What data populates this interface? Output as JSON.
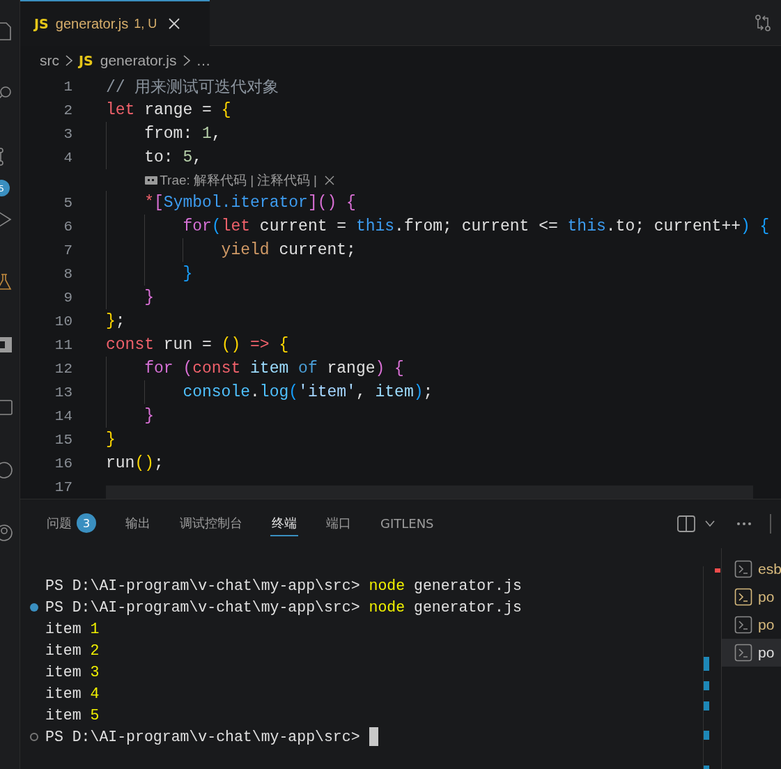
{
  "activity_bar": {
    "items": [
      {
        "kind": "files"
      },
      {
        "kind": "search"
      },
      {
        "kind": "source_control",
        "badge": "5"
      },
      {
        "kind": "run"
      },
      {
        "kind": "flask"
      },
      {
        "kind": "filled_square"
      },
      {
        "kind": "window"
      },
      {
        "kind": "circle"
      },
      {
        "kind": "account"
      }
    ]
  },
  "editor_tabs": [
    {
      "icon": "JS",
      "title": "generator.js",
      "status": "1, U",
      "selected": true
    }
  ],
  "breadcrumbs": [
    {
      "text": "src"
    },
    {
      "icon": "JS",
      "text": "generator.js"
    },
    {
      "text": "…"
    }
  ],
  "code": {
    "lines": [
      {
        "kind": "code",
        "number": "1",
        "tokens": [
          {
            "t": "// 用来测试可迭代对象",
            "kind": "comment"
          }
        ]
      },
      {
        "kind": "code",
        "number": "2",
        "tokens": [
          {
            "t": "let",
            "kind": "kw"
          },
          {
            "t": " range = ",
            "kind": "plain"
          },
          {
            "t": "{",
            "kind": "b1"
          }
        ],
        "children": [
          {
            "kind": "code",
            "number": "3",
            "tokens": [
              {
                "t": "from: ",
                "kind": "plain"
              },
              {
                "t": "1",
                "kind": "num"
              },
              {
                "t": ",",
                "kind": "plain"
              }
            ]
          },
          {
            "kind": "code",
            "number": "4",
            "tokens": [
              {
                "t": "to: ",
                "kind": "plain"
              },
              {
                "t": "5",
                "kind": "num"
              },
              {
                "t": ",",
                "kind": "plain"
              }
            ]
          },
          {
            "kind": "codelens",
            "prefix": "Trae:",
            "actions": [
              "解释代码",
              "注释代码"
            ],
            "separator": "|"
          },
          {
            "kind": "code",
            "number": "5",
            "tokens": [
              {
                "t": "*",
                "kind": "kw"
              },
              {
                "t": "[",
                "kind": "b2"
              },
              {
                "t": "Symbol.iterator",
                "kind": "this"
              },
              {
                "t": "]() {",
                "kind": "b2"
              }
            ],
            "children": [
              {
                "kind": "code",
                "number": "6",
                "tokens": [
                  {
                    "t": "for",
                    "kind": "ctrl"
                  },
                  {
                    "t": "(",
                    "kind": "b3"
                  },
                  {
                    "t": "let",
                    "kind": "kw"
                  },
                  {
                    "t": " current = ",
                    "kind": "plain"
                  },
                  {
                    "t": "this",
                    "kind": "this"
                  },
                  {
                    "t": ".from; current <= ",
                    "kind": "plain"
                  },
                  {
                    "t": "this",
                    "kind": "this"
                  },
                  {
                    "t": ".to; current++",
                    "kind": "plain"
                  },
                  {
                    "t": ") {",
                    "kind": "b3"
                  }
                ],
                "children": [
                  {
                    "kind": "code",
                    "number": "7",
                    "tokens": [
                      {
                        "t": "yield",
                        "kind": "yield"
                      },
                      {
                        "t": " current;",
                        "kind": "plain"
                      }
                    ]
                  }
                ]
              },
              {
                "kind": "code",
                "number": "8",
                "tokens": [
                  {
                    "t": "}",
                    "kind": "b3"
                  }
                ]
              }
            ]
          },
          {
            "kind": "code",
            "number": "9",
            "tokens": [
              {
                "t": "}",
                "kind": "b2"
              }
            ]
          }
        ]
      },
      {
        "kind": "code",
        "number": "10",
        "tokens": [
          {
            "t": "}",
            "kind": "b1"
          },
          {
            "t": ";",
            "kind": "plain"
          }
        ]
      },
      {
        "kind": "code",
        "number": "11",
        "tokens": [
          {
            "t": "const",
            "kind": "kw"
          },
          {
            "t": " run = ",
            "kind": "plain"
          },
          {
            "t": "() ",
            "kind": "b1"
          },
          {
            "t": "=> ",
            "kind": "kw"
          },
          {
            "t": "{",
            "kind": "b1"
          }
        ],
        "children": [
          {
            "kind": "code",
            "number": "12",
            "tokens": [
              {
                "t": "for ",
                "kind": "ctrl"
              },
              {
                "t": "(",
                "kind": "b2"
              },
              {
                "t": "const ",
                "kind": "kw"
              },
              {
                "t": "item ",
                "kind": "var"
              },
              {
                "t": "of",
                "kind": "storage"
              },
              {
                "t": " range",
                "kind": "plain"
              },
              {
                "t": ") {",
                "kind": "b2"
              }
            ],
            "children": [
              {
                "kind": "code",
                "number": "13",
                "tokens": [
                  {
                    "t": "console",
                    "kind": "builtin"
                  },
                  {
                    "t": ".",
                    "kind": "plain"
                  },
                  {
                    "t": "log",
                    "kind": "builtin"
                  },
                  {
                    "t": "(",
                    "kind": "b3"
                  },
                  {
                    "t": "'item'",
                    "kind": "string"
                  },
                  {
                    "t": ", ",
                    "kind": "plain"
                  },
                  {
                    "t": "item",
                    "kind": "var"
                  },
                  {
                    "t": ")",
                    "kind": "b3"
                  },
                  {
                    "t": ";",
                    "kind": "plain"
                  }
                ]
              }
            ]
          },
          {
            "kind": "code",
            "number": "14",
            "tokens": [
              {
                "t": "}",
                "kind": "b2"
              }
            ]
          }
        ]
      },
      {
        "kind": "code",
        "number": "15",
        "tokens": [
          {
            "t": "}",
            "kind": "b1"
          }
        ]
      },
      {
        "kind": "code",
        "number": "16",
        "tokens": [
          {
            "t": "run",
            "kind": "plain"
          },
          {
            "t": "()",
            "kind": "b1"
          },
          {
            "t": ";",
            "kind": "plain"
          }
        ]
      },
      {
        "kind": "code",
        "number": "17"
      }
    ]
  },
  "panel": {
    "tabs": [
      {
        "label": "问题",
        "badge": "3",
        "selected": false
      },
      {
        "label": "输出",
        "selected": false
      },
      {
        "label": "调试控制台",
        "selected": false
      },
      {
        "label": "终端",
        "selected": true
      },
      {
        "label": "端口",
        "selected": false
      },
      {
        "label": "GITLENS",
        "selected": false
      }
    ],
    "terminal": {
      "lines": [
        {
          "kind": "plain",
          "parts": [
            {
              "t": "PS D:\\AI-program\\v-chat\\my-app\\src> ",
              "kind": "plain"
            },
            {
              "t": "node",
              "kind": "cmd"
            },
            {
              "t": " generator.js",
              "kind": "plain"
            }
          ]
        },
        {
          "kind": "success",
          "parts": [
            {
              "t": "PS D:\\AI-program\\v-chat\\my-app\\src> ",
              "kind": "plain"
            },
            {
              "t": "node",
              "kind": "cmd"
            },
            {
              "t": " generator.js",
              "kind": "plain"
            }
          ]
        },
        {
          "kind": "plain",
          "parts": [
            {
              "t": "item ",
              "kind": "plain"
            },
            {
              "t": "1",
              "kind": "num"
            }
          ]
        },
        {
          "kind": "plain",
          "parts": [
            {
              "t": "item ",
              "kind": "plain"
            },
            {
              "t": "2",
              "kind": "num"
            }
          ]
        },
        {
          "kind": "plain",
          "parts": [
            {
              "t": "item ",
              "kind": "plain"
            },
            {
              "t": "3",
              "kind": "num"
            }
          ]
        },
        {
          "kind": "plain",
          "parts": [
            {
              "t": "item ",
              "kind": "plain"
            },
            {
              "t": "4",
              "kind": "num"
            }
          ]
        },
        {
          "kind": "plain",
          "parts": [
            {
              "t": "item ",
              "kind": "plain"
            },
            {
              "t": "5",
              "kind": "num"
            }
          ]
        },
        {
          "kind": "pending",
          "cursor": true,
          "parts": [
            {
              "t": "PS D:\\AI-program\\v-chat\\my-app\\src> ",
              "kind": "plain"
            }
          ]
        }
      ]
    },
    "terminal_list": [
      {
        "name": "esb",
        "icon_active": false,
        "color": "#d7ba7d",
        "selected": false
      },
      {
        "name": "po",
        "icon_active": true,
        "color": "#d7ba7d",
        "selected": false
      },
      {
        "name": "po",
        "icon_active": false,
        "color": "#d7ba7d",
        "selected": false
      },
      {
        "name": "po",
        "icon_active": false,
        "color": "#e0e0e0",
        "selected": true
      }
    ]
  }
}
